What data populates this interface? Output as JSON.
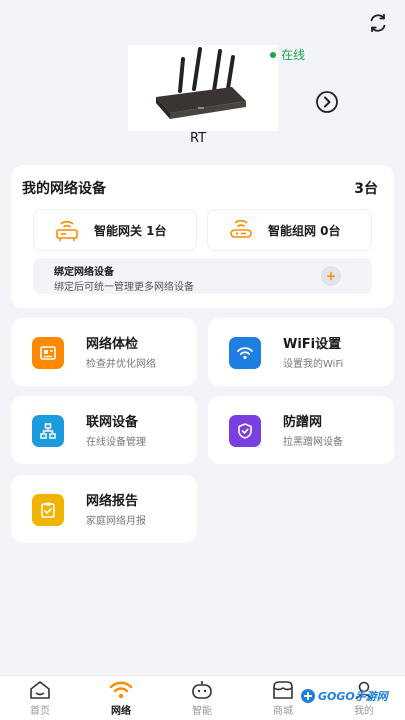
{
  "header": {
    "status": "在线",
    "router_name": "RT"
  },
  "devices": {
    "title": "我的网络设备",
    "count": "3台",
    "gateway_label": "智能网关  1台",
    "mesh_label": "智能组网  0台",
    "bind_title": "绑定网络设备",
    "bind_subtitle": "绑定后可统一管理更多网络设备",
    "bind_button": "+"
  },
  "tiles": [
    {
      "title": "网络体检",
      "subtitle": "检查并优化网络",
      "color": "#ff8a00",
      "icon": "report-icon"
    },
    {
      "title": "WiFi设置",
      "subtitle": "设置我的WiFi",
      "color": "#1e7fe0",
      "icon": "wifi-icon"
    },
    {
      "title": "联网设备",
      "subtitle": "在线设备管理",
      "color": "#1e9be0",
      "icon": "network-devices-icon"
    },
    {
      "title": "防蹭网",
      "subtitle": "拉黑蹭网设备",
      "color": "#7a3fe0",
      "icon": "shield-icon"
    },
    {
      "title": "网络报告",
      "subtitle": "家庭网络月报",
      "color": "#f0b400",
      "icon": "clipboard-icon"
    }
  ],
  "nav": [
    {
      "label": "首页",
      "icon": "home-icon",
      "active": false
    },
    {
      "label": "网络",
      "icon": "wifi-icon",
      "active": true
    },
    {
      "label": "智能",
      "icon": "robot-icon",
      "active": false
    },
    {
      "label": "商城",
      "icon": "shop-icon",
      "active": false
    },
    {
      "label": "我的",
      "icon": "profile-icon",
      "active": false
    }
  ],
  "watermark": "GOGO手游网",
  "colors": {
    "accent": "#ff8a00",
    "online": "#1aa34a",
    "background": "#f3f4f8"
  }
}
